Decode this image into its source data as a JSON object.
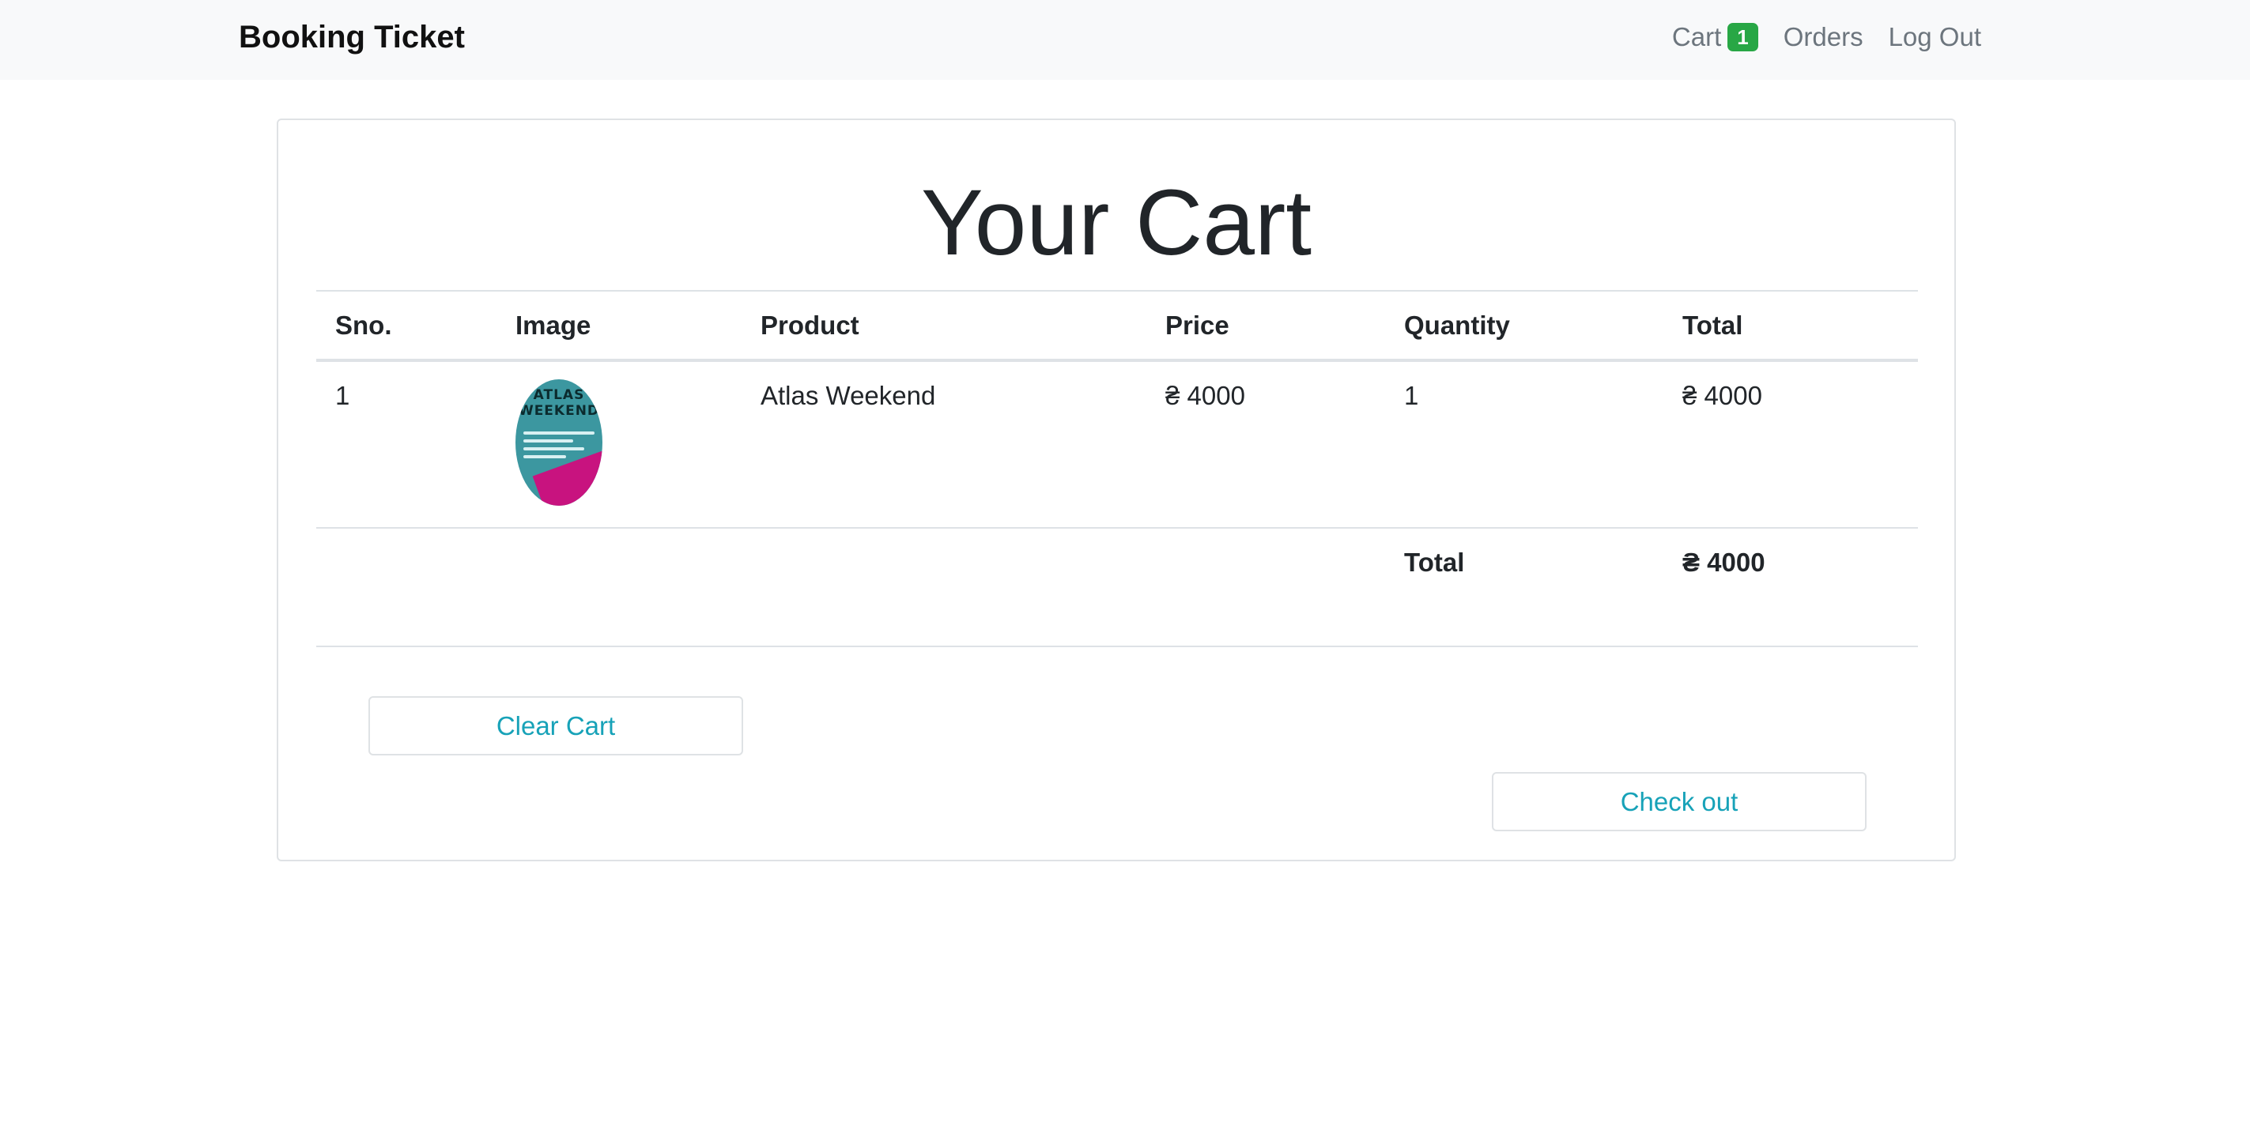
{
  "navbar": {
    "brand": "Booking Ticket",
    "cart_label": "Cart",
    "cart_count": "1",
    "orders_label": "Orders",
    "logout_label": "Log Out"
  },
  "page": {
    "title": "Your Cart"
  },
  "table": {
    "headers": [
      "Sno.",
      "Image",
      "Product",
      "Price",
      "Quantity",
      "Total"
    ],
    "rows": [
      {
        "sno": "1",
        "image_text": "ATLAS WEEKEND",
        "product": "Atlas Weekend",
        "price": "₴ 4000",
        "quantity": "1",
        "total": "₴ 4000"
      }
    ],
    "summary": {
      "label": "Total",
      "value": "₴ 4000"
    }
  },
  "actions": {
    "clear_label": "Clear Cart",
    "checkout_label": "Check out"
  },
  "colors": {
    "navbar_bg": "#f8f9fa",
    "badge": "#28a745",
    "button_text": "#17a2b8"
  }
}
